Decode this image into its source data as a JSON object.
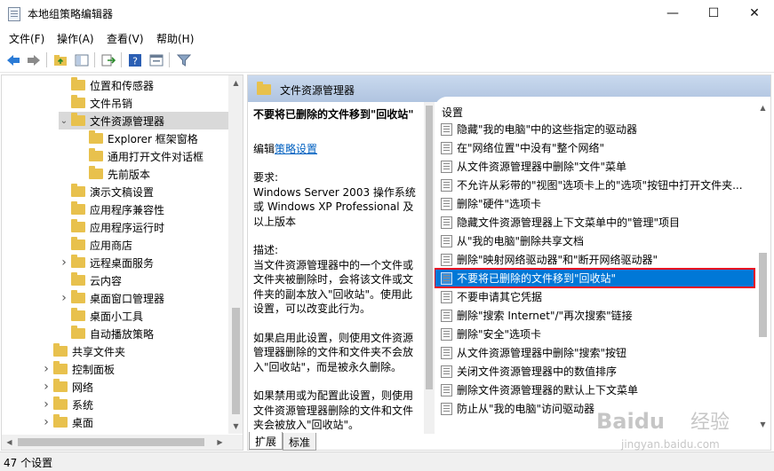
{
  "window": {
    "title": "本地组策略编辑器",
    "minimize": "—",
    "maximize": "☐",
    "close": "✕"
  },
  "menu": [
    {
      "id": "file",
      "label": "文件(F)"
    },
    {
      "id": "action",
      "label": "操作(A)"
    },
    {
      "id": "view",
      "label": "查看(V)"
    },
    {
      "id": "help",
      "label": "帮助(H)"
    }
  ],
  "toolbar": [
    "back-icon",
    "forward-icon",
    "up-folder-icon",
    "show-hide-tree-icon",
    "export-list-icon",
    "help-icon",
    "properties-icon",
    "filter-icon"
  ],
  "tree": [
    {
      "label": "位置和传感器",
      "indent": 2,
      "expander": ""
    },
    {
      "label": "文件吊销",
      "indent": 2,
      "expander": ""
    },
    {
      "label": "文件资源管理器",
      "indent": 2,
      "expander": "open",
      "selected": true
    },
    {
      "label": "Explorer 框架窗格",
      "indent": 3,
      "expander": ""
    },
    {
      "label": "通用打开文件对话框",
      "indent": 3,
      "expander": ""
    },
    {
      "label": "先前版本",
      "indent": 3,
      "expander": ""
    },
    {
      "label": "演示文稿设置",
      "indent": 2,
      "expander": ""
    },
    {
      "label": "应用程序兼容性",
      "indent": 2,
      "expander": ""
    },
    {
      "label": "应用程序运行时",
      "indent": 2,
      "expander": ""
    },
    {
      "label": "应用商店",
      "indent": 2,
      "expander": ""
    },
    {
      "label": "远程桌面服务",
      "indent": 2,
      "expander": "closed"
    },
    {
      "label": "云内容",
      "indent": 2,
      "expander": ""
    },
    {
      "label": "桌面窗口管理器",
      "indent": 2,
      "expander": "closed"
    },
    {
      "label": "桌面小工具",
      "indent": 2,
      "expander": ""
    },
    {
      "label": "自动播放策略",
      "indent": 2,
      "expander": ""
    },
    {
      "label": "共享文件夹",
      "indent": 1,
      "expander": ""
    },
    {
      "label": "控制面板",
      "indent": 1,
      "expander": "closed"
    },
    {
      "label": "网络",
      "indent": 1,
      "expander": "closed"
    },
    {
      "label": "系统",
      "indent": 1,
      "expander": "closed"
    },
    {
      "label": "桌面",
      "indent": 1,
      "expander": "closed"
    }
  ],
  "right": {
    "header": "文件资源管理器",
    "desc": {
      "title": "不要将已删除的文件移到\"回收站\"",
      "edit_prefix": "编辑",
      "edit_link": "策略设置",
      "req_label": "要求:",
      "req_text": "Windows Server 2003 操作系统或 Windows XP Professional 及以上版本",
      "desc_label": "描述:",
      "desc_text": "当文件资源管理器中的一个文件或文件夹被删除时，会将该文件或文件夹的副本放入\"回收站\"。使用此设置，可以改变此行为。",
      "enabled_text": "如果启用此设置，则使用文件资源管理器删除的文件和文件夹不会放入\"回收站\"，而是被永久删除。",
      "disabled_text": "如果禁用或为配置此设置，则使用文件资源管理器删除的文件和文件夹会被放入\"回收站\"。"
    },
    "settings_header": "设置",
    "settings": [
      "隐藏\"我的电脑\"中的这些指定的驱动器",
      "在\"网络位置\"中没有\"整个网络\"",
      "从文件资源管理器中删除\"文件\"菜单",
      "不允许从彩带的\"视图\"选项卡上的\"选项\"按钮中打开文件夹...",
      "删除\"硬件\"选项卡",
      "隐藏文件资源管理器上下文菜单中的\"管理\"项目",
      "从\"我的电脑\"删除共享文档",
      "删除\"映射网络驱动器\"和\"断开网络驱动器\"",
      "不要将已删除的文件移到\"回收站\"",
      "不要申请其它凭据",
      "删除\"搜索 Internet\"/\"再次搜索\"链接",
      "删除\"安全\"选项卡",
      "从文件资源管理器中删除\"搜索\"按钮",
      "关闭文件资源管理器中的数值排序",
      "删除文件资源管理器的默认上下文菜单",
      "防止从\"我的电脑\"访问驱动器"
    ],
    "selected_index": 8,
    "tabs": [
      "扩展",
      "标准"
    ]
  },
  "status": {
    "text": "47 个设置"
  },
  "watermark": {
    "brand": "Baidu",
    "brand2": "经验",
    "url": "jingyan.baidu.com"
  },
  "colors": {
    "selection": "#0078d7",
    "highlight_border": "#e81123",
    "folder": "#e8c14d",
    "link": "#0060c0"
  }
}
